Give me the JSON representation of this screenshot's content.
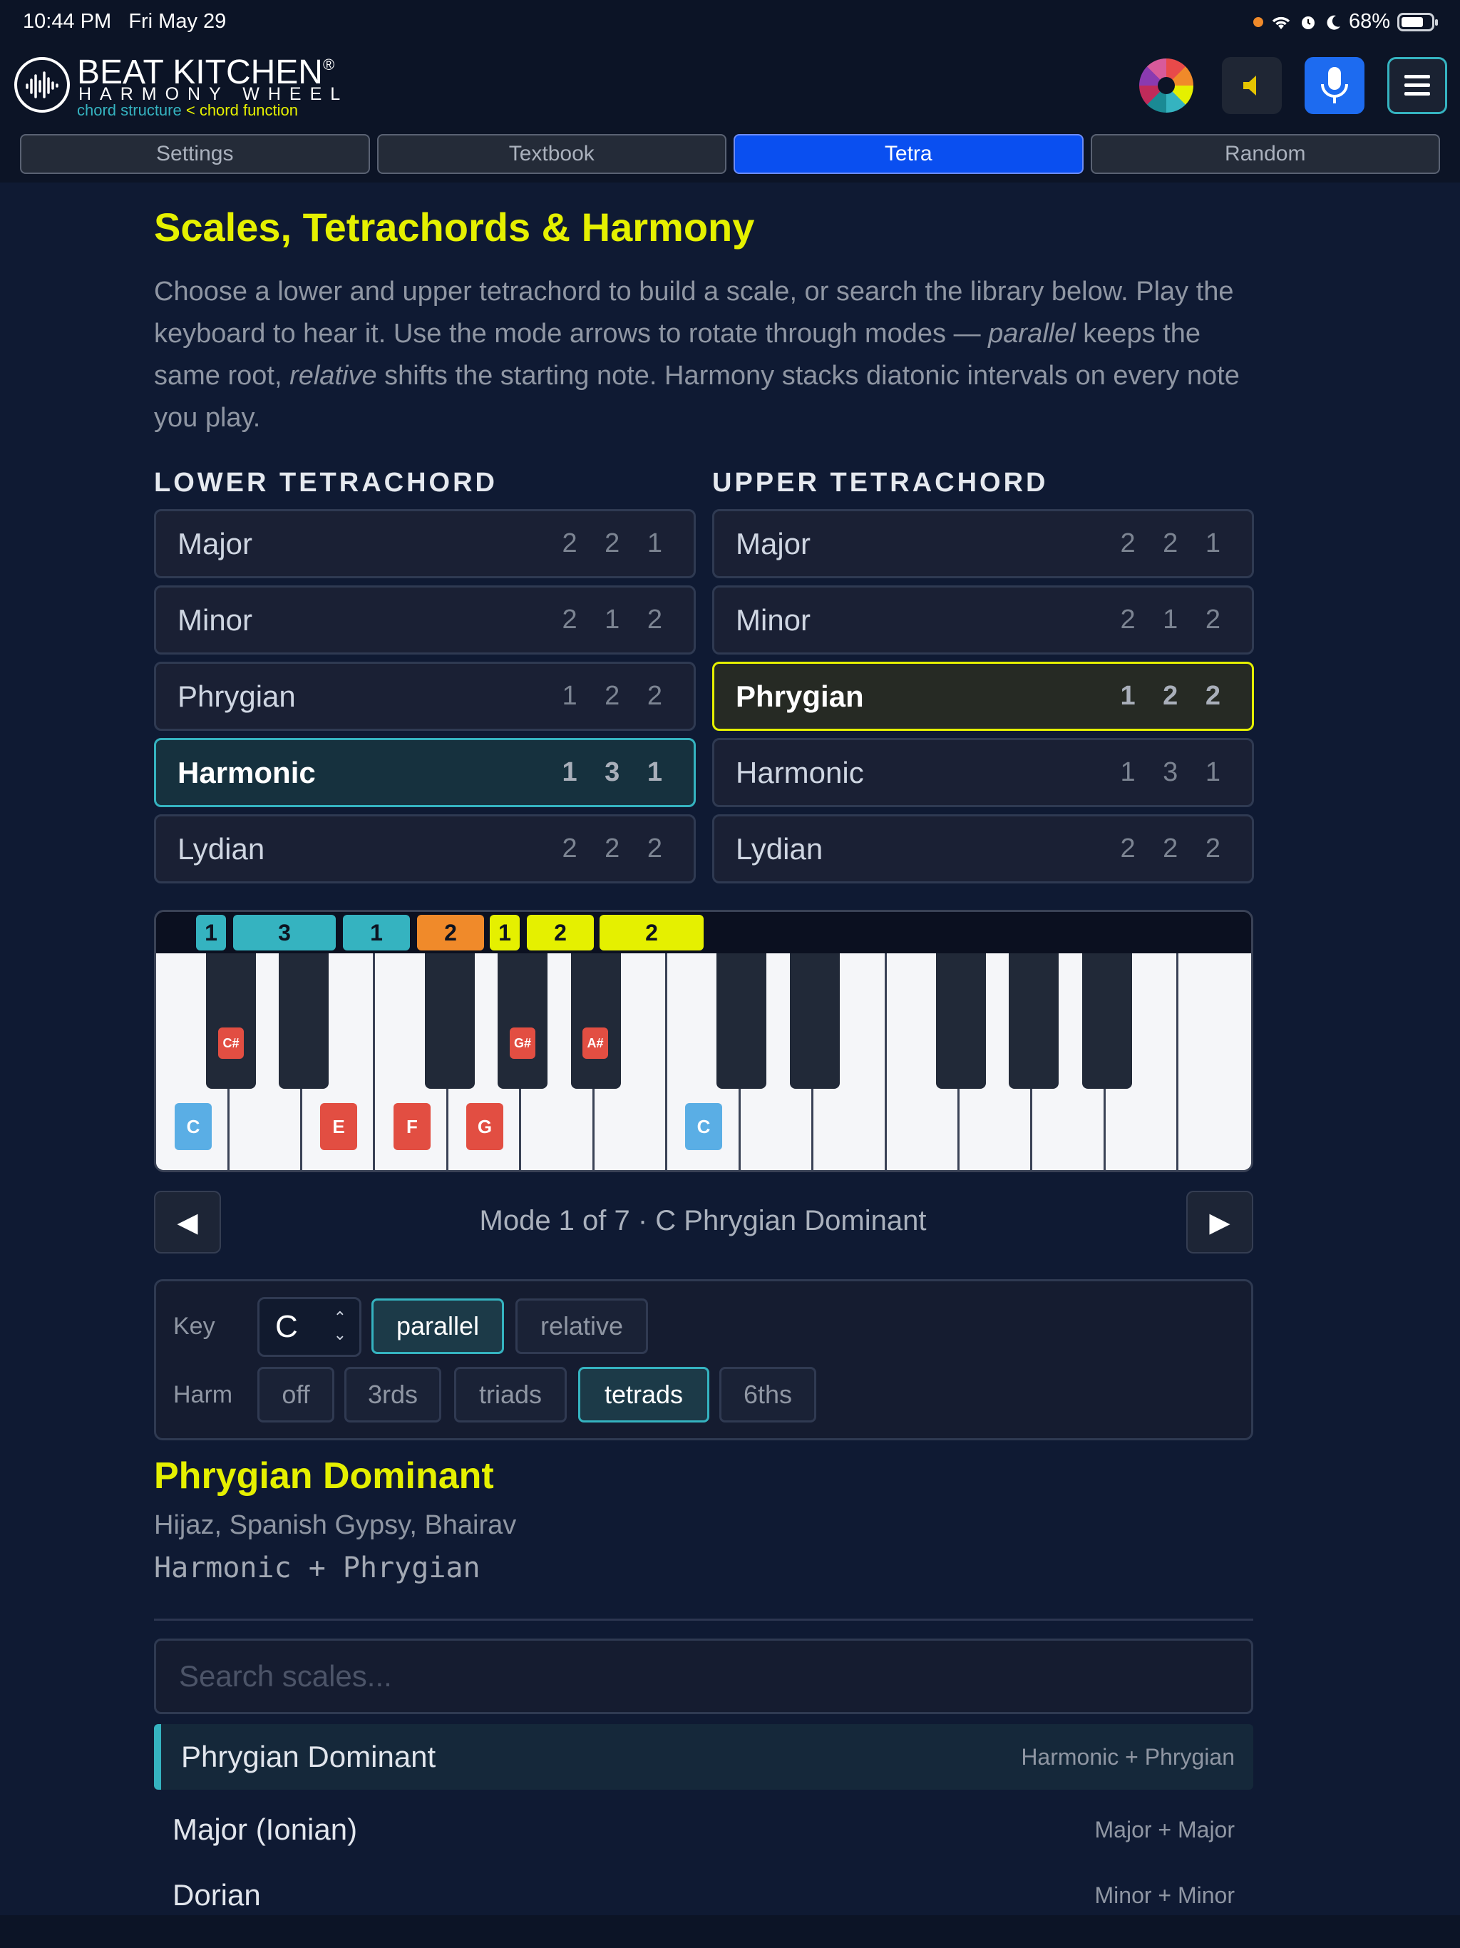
{
  "status": {
    "time": "10:44 PM",
    "date": "Fri May 29",
    "battery": "68%"
  },
  "app": {
    "title": "BEAT KITCHEN",
    "registered": "®",
    "subtitle": "HARMONY WHEEL",
    "tagline_a": "chord structure",
    "tagline_sep": " < ",
    "tagline_b": "chord function"
  },
  "header_icons": [
    "color-wheel-icon",
    "speaker-icon",
    "microphone-icon",
    "menu-icon"
  ],
  "tabs": [
    {
      "label": "Settings",
      "active": false
    },
    {
      "label": "Textbook",
      "active": false
    },
    {
      "label": "Tetra",
      "active": true
    },
    {
      "label": "Random",
      "active": false
    }
  ],
  "page": {
    "title": "Scales, Tetrachords & Harmony",
    "intro_1": "Choose a lower and upper tetrachord to build a scale, or search the library below. Play the keyboard to hear it. Use the mode arrows to rotate through modes — ",
    "intro_parallel": "parallel",
    "intro_2": " keeps the same root, ",
    "intro_relative": "relative",
    "intro_3": " shifts the starting note. Harmony stacks diatonic intervals on every note you play."
  },
  "lower": {
    "heading": "LOWER TETRACHORD",
    "items": [
      {
        "name": "Major",
        "steps": "2 2 1"
      },
      {
        "name": "Minor",
        "steps": "2 1 2"
      },
      {
        "name": "Phrygian",
        "steps": "1 2 2"
      },
      {
        "name": "Harmonic",
        "steps": "1 3 1",
        "selected": true
      },
      {
        "name": "Lydian",
        "steps": "2 2 2"
      }
    ]
  },
  "upper": {
    "heading": "UPPER TETRACHORD",
    "items": [
      {
        "name": "Major",
        "steps": "2 2 1"
      },
      {
        "name": "Minor",
        "steps": "2 1 2"
      },
      {
        "name": "Phrygian",
        "steps": "1 2 2",
        "selected": true
      },
      {
        "name": "Harmonic",
        "steps": "1 3 1"
      },
      {
        "name": "Lydian",
        "steps": "2 2 2"
      }
    ]
  },
  "keyboard": {
    "intervals": [
      "1",
      "3",
      "1",
      "2",
      "1",
      "2",
      "2"
    ],
    "notes": {
      "c1": "C",
      "cs": "C#",
      "e": "E",
      "f": "F",
      "g": "G",
      "gs": "G#",
      "as": "A#",
      "c2": "C"
    },
    "colors": {
      "lower": "#35b3c0",
      "bridge": "#f08a2a",
      "upper": "#e5f000",
      "note_red": "#e24e42",
      "note_blue": "#5aaee5"
    }
  },
  "mode": {
    "prev": "◀",
    "next": "▶",
    "text": "Mode 1 of 7 · C Phrygian Dominant"
  },
  "controls": {
    "key_label": "Key",
    "key_value": "C",
    "parallel": "parallel",
    "relative": "relative",
    "harm_label": "Harm",
    "harm_options": [
      "off",
      "3rds",
      "triads",
      "tetrads",
      "6ths"
    ],
    "harm_selected": "tetrads",
    "mode_selected": "parallel"
  },
  "scale": {
    "name": "Phrygian Dominant",
    "aliases": "Hijaz, Spanish Gypsy, Bhairav",
    "formula": "Harmonic + Phrygian"
  },
  "search": {
    "placeholder": "Search scales..."
  },
  "library": [
    {
      "name": "Phrygian Dominant",
      "combo": "Harmonic + Phrygian",
      "selected": true
    },
    {
      "name": "Major (Ionian)",
      "combo": "Major + Major"
    },
    {
      "name": "Dorian",
      "combo": "Minor + Minor"
    }
  ]
}
